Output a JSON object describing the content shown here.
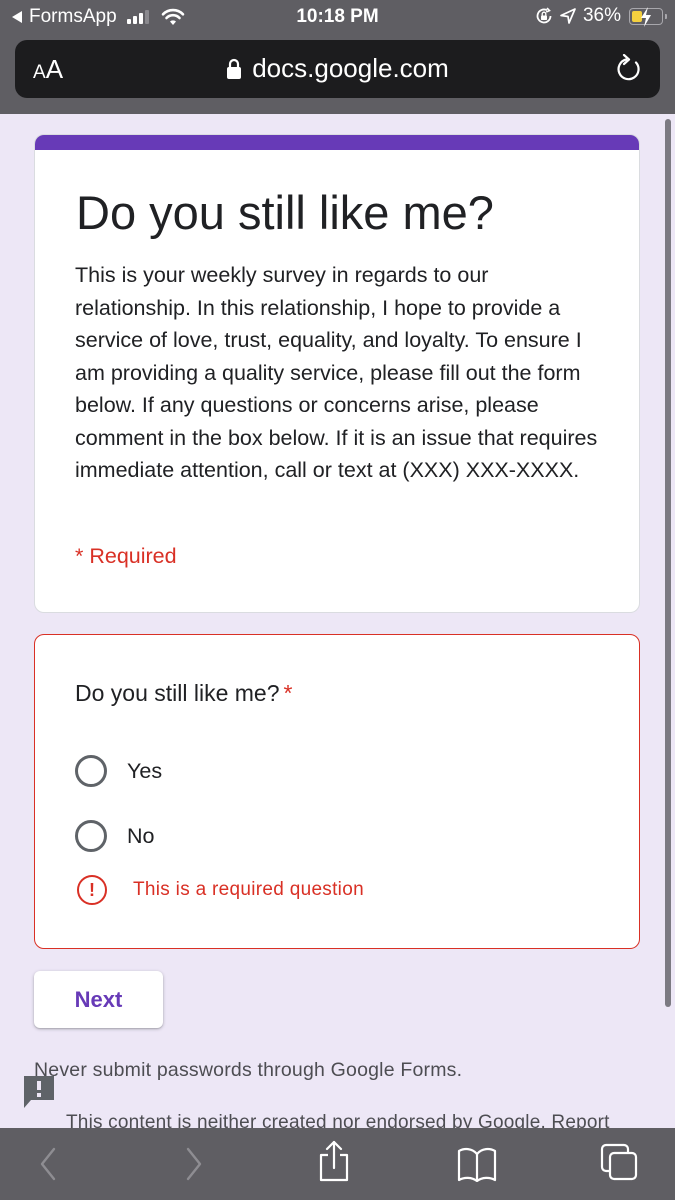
{
  "status_bar": {
    "back_app": "FormsApp",
    "time": "10:18 PM",
    "battery_percent": "36%",
    "battery_level": 0.36,
    "charging": true,
    "icons": [
      "back-arrow-icon",
      "signal-icon",
      "wifi-icon",
      "rotation-lock-icon",
      "location-icon",
      "battery-icon"
    ]
  },
  "address_bar": {
    "text_size_label": "AA",
    "url": "docs.google.com",
    "icons": [
      "lock-icon",
      "reload-icon"
    ]
  },
  "form": {
    "accent_color": "#673ab7",
    "title": "Do you still like me?",
    "description": "This is your weekly survey in regards to our relationship. In this relationship, I hope to provide a service of love, trust, equality, and loyalty. To ensure I am providing a quality service, please fill out the form below. If any questions or concerns arise, please comment in the box below. If it is an issue that requires immediate attention, call or text at (XXX) XXX-XXXX.",
    "required_note": "* Required",
    "question": {
      "title": "Do you still like me?",
      "required_marker": "*",
      "options": [
        {
          "label": "Yes",
          "selected": false
        },
        {
          "label": "No",
          "selected": false
        }
      ],
      "error_message": "This is a required question",
      "error_color": "#d93025"
    },
    "next_button": "Next",
    "password_warning": "Never submit passwords through Google Forms.",
    "disclaimer": "This content is neither created nor endorsed by Google. Report"
  },
  "toolbar": {
    "buttons": [
      "back",
      "forward",
      "share",
      "bookmarks",
      "tabs"
    ]
  }
}
